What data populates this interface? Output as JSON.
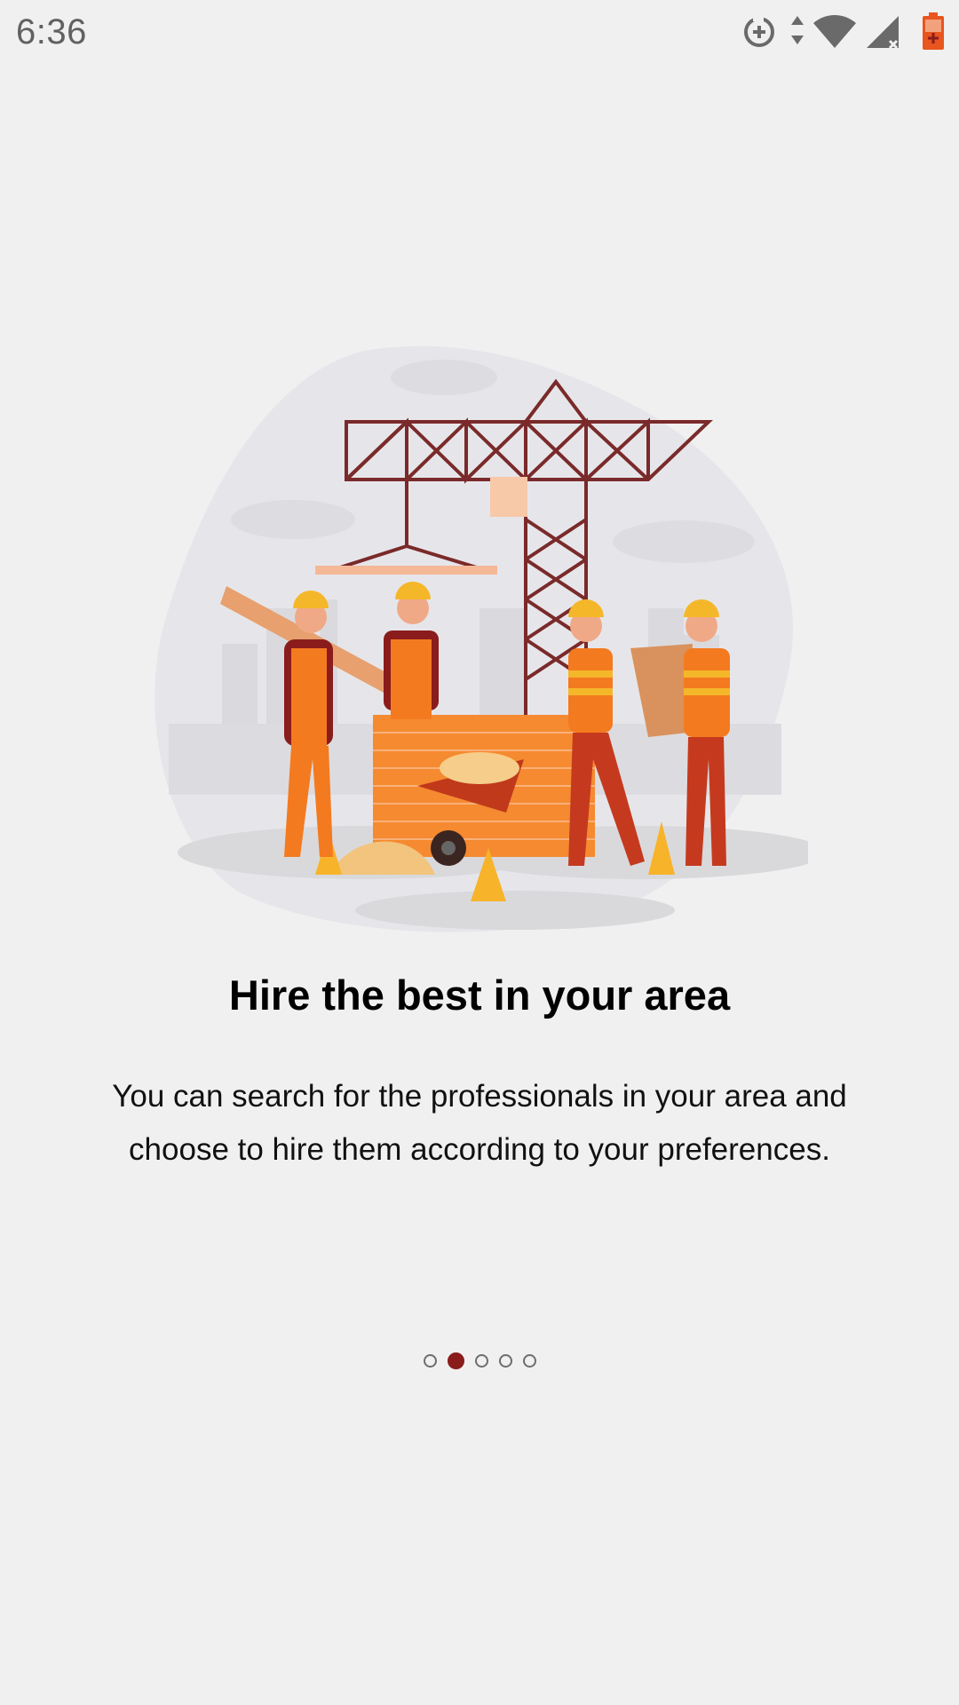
{
  "status_bar": {
    "time": "6:36",
    "icons": [
      "sync-add-icon",
      "data-arrows-icon",
      "wifi-icon",
      "cell-signal-icon",
      "battery-icon"
    ]
  },
  "onboarding": {
    "illustration": "construction-workers-illustration",
    "title": "Hire the best in your area",
    "description": "You can search for the professionals in your area and choose to hire them according to your preferences.",
    "pager": {
      "total": 5,
      "active_index": 1
    }
  },
  "colors": {
    "background": "#f0f0f1",
    "accent": "#8a1c1c",
    "orange": "#f47a20",
    "helmet": "#f5b72a"
  }
}
